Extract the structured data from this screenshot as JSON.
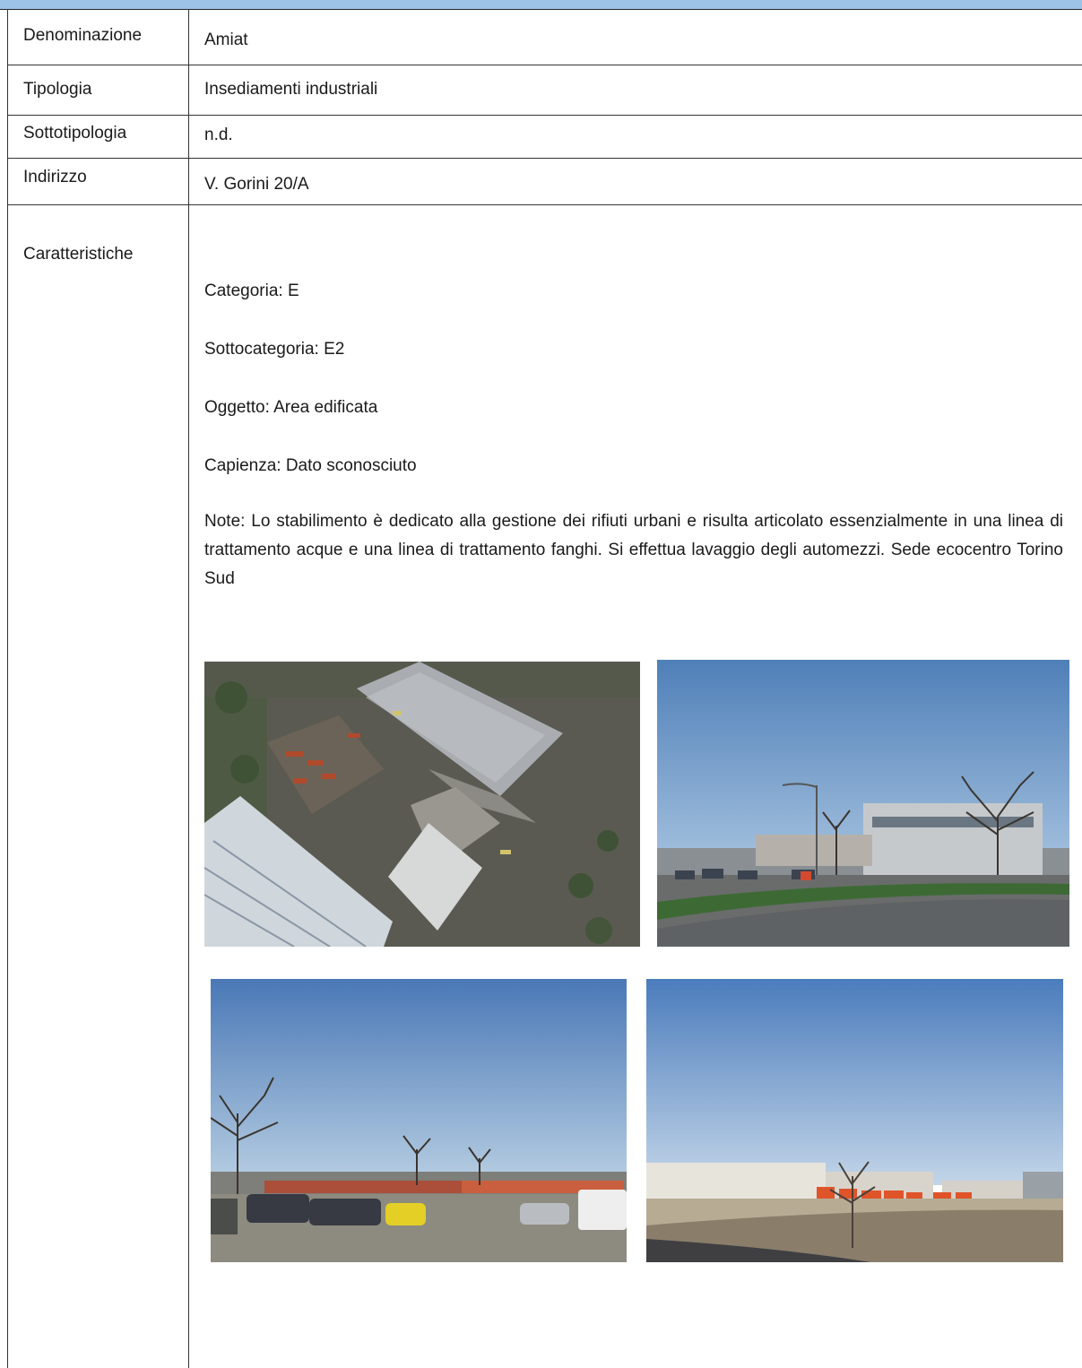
{
  "rows": {
    "denominazione": {
      "label": "Denominazione",
      "value": "Amiat"
    },
    "tipologia": {
      "label": "Tipologia",
      "value": "Insediamenti industriali"
    },
    "sottotipologia": {
      "label": "Sottotipologia",
      "value": "n.d."
    },
    "indirizzo": {
      "label": "Indirizzo",
      "value": "V. Gorini 20/A"
    },
    "caratteristiche": {
      "label": "Caratteristiche"
    }
  },
  "details": {
    "categoria": "Categoria: E",
    "sottocategoria": "Sottocategoria: E2",
    "oggetto": "Oggetto: Area edificata",
    "capienza": "Capienza: Dato sconosciuto",
    "note": "Note: Lo stabilimento è dedicato alla gestione dei rifiuti urbani e risulta articolato essenzialmente in una linea di trattamento acque e una linea di trattamento fanghi. Si effettua lavaggio degli automezzi. Sede ecocentro Torino Sud"
  },
  "colors": {
    "header_band": "#9dc3e6",
    "grid": "#333333"
  }
}
